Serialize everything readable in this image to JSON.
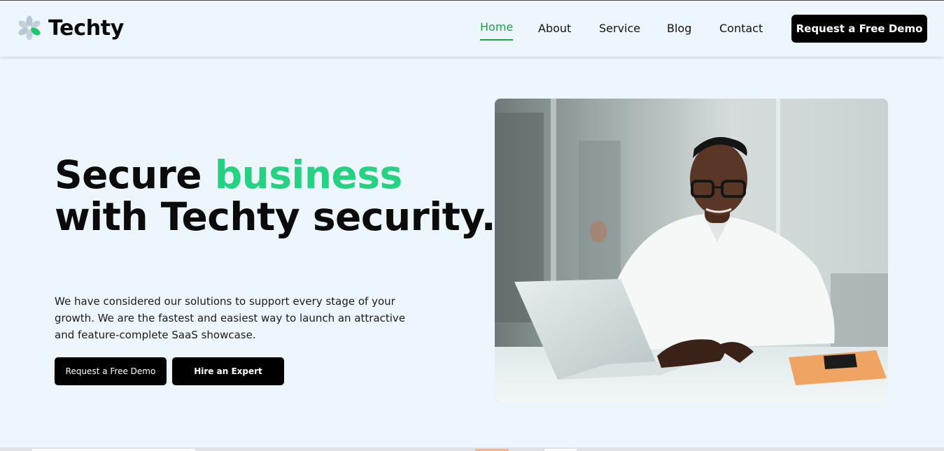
{
  "brand": {
    "name": "Techty",
    "icon": "flower-logo-icon"
  },
  "nav": {
    "items": [
      {
        "label": "Home",
        "active": true
      },
      {
        "label": "About",
        "active": false
      },
      {
        "label": "Service",
        "active": false
      },
      {
        "label": "Blog",
        "active": false
      },
      {
        "label": "Contact",
        "active": false
      }
    ],
    "cta": "Request a Free Demo"
  },
  "hero": {
    "title_part1": "Secure ",
    "title_accent": "business",
    "title_part2": "with Techty security.",
    "description": "We have considered our solutions to support every stage of your growth. We are the fastest and easiest way to launch an attractive and feature-complete SaaS showcase.",
    "primary_button": "Request a Free Demo",
    "secondary_button": "Hire an Expert",
    "image": "man-with-laptop-photo"
  },
  "colors": {
    "accent": "#27d182",
    "nav_active": "#17a34a",
    "background": "#eef6fd",
    "button": "#000000"
  }
}
